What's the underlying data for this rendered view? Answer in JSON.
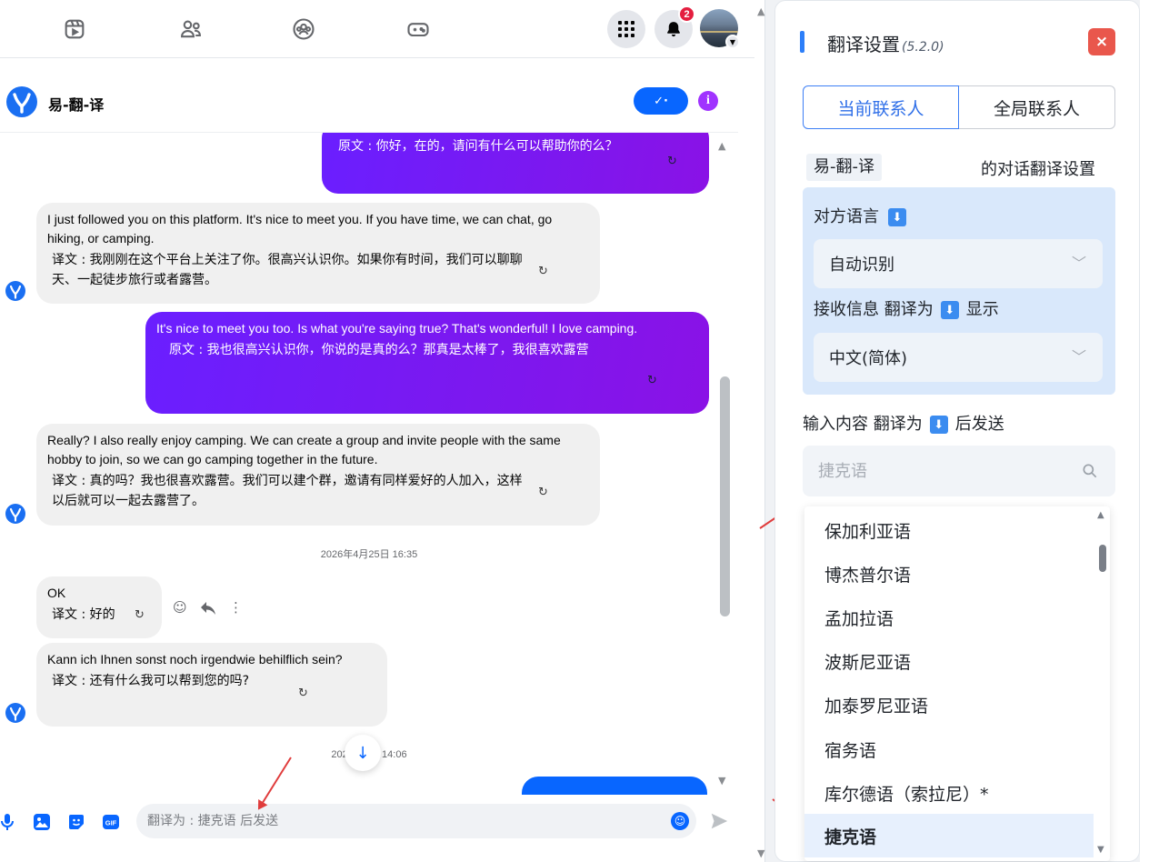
{
  "topnav": {
    "icons": [
      "reels-icon",
      "friends-icon",
      "groups-icon",
      "gaming-icon"
    ],
    "notification_count": "2"
  },
  "chat": {
    "title": "易-翻-译",
    "check_label": "✓·",
    "info_label": "i",
    "messages": [
      {
        "dir": "out",
        "original": "",
        "translation": "原文 : 你好，在的，请问有什么可以帮助你的么？"
      },
      {
        "dir": "in",
        "original": "I just followed you on this platform. It's nice to meet you. If you have time, we can chat, go hiking, or camping.",
        "translation": "译文 : 我刚刚在这个平台上关注了你。很高兴认识你。如果你有时间，我们可以聊聊天、一起徒步旅行或者露营。"
      },
      {
        "dir": "out",
        "original": "It's nice to meet you too. Is what you're saying true? That's wonderful! I love camping.",
        "translation": "原文 : 我也很高兴认识你，你说的是真的么？那真是太棒了，我很喜欢露营"
      },
      {
        "dir": "in",
        "original": "Really? I also really enjoy camping. We can create a group and invite people with the same hobby to join, so we can go camping together in the future.",
        "translation": "译文 : 真的吗？我也很喜欢露营。我们可以建个群，邀请有同样爱好的人加入，这样以后就可以一起去露营了。"
      },
      {
        "dir": "in",
        "original": "OK",
        "translation": "译文 : 好的"
      },
      {
        "dir": "in",
        "original": "Kann ich Ihnen sonst noch irgendwie behilflich sein?",
        "translation": "译文 : 还有什么我可以帮到您的吗?"
      }
    ],
    "timestamps": [
      "2026年4月25日 16:35",
      "2026年4月 14:06"
    ],
    "composer_placeholder": "翻译为 : 捷克语 后发送"
  },
  "settings": {
    "title": "翻译设置",
    "version": "(5.2.0)",
    "close_label": "×",
    "tabs": [
      "当前联系人",
      "全局联系人"
    ],
    "contact_name": "易-翻-译",
    "contact_suffix": "的对话翻译设置",
    "peer_lang_label": "对方语言",
    "peer_lang_value": "自动识别",
    "receive_prefix": "接收信息 翻译为",
    "receive_suffix": "显示",
    "receive_lang_value": "中文(简体)",
    "send_prefix": "输入内容 翻译为",
    "send_suffix": "后发送",
    "search_placeholder": "捷克语",
    "languages": [
      "保加利亚语",
      "博杰普尔语",
      "孟加拉语",
      "波斯尼亚语",
      "加泰罗尼亚语",
      "宿务语",
      "库尔德语（索拉尼）*",
      "捷克语"
    ],
    "selected_language": "捷克语"
  },
  "colors": {
    "accent_blue": "#0866ff",
    "bubble_purple": "#7c18ef",
    "annotation_red": "#e03c3c",
    "settings_blue": "#2f6fe8"
  }
}
